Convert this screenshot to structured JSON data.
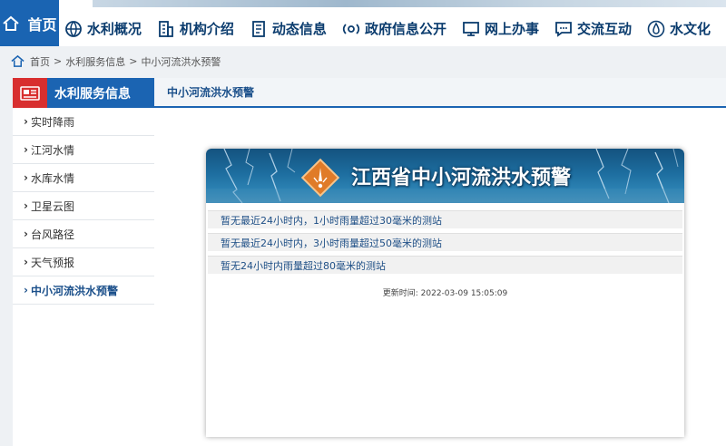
{
  "nav": {
    "home": "首页",
    "items": [
      {
        "label": "水利概况",
        "icon": "globe-icon"
      },
      {
        "label": "机构介绍",
        "icon": "building-icon"
      },
      {
        "label": "动态信息",
        "icon": "document-icon"
      },
      {
        "label": "政府信息公开",
        "icon": "broadcast-icon"
      },
      {
        "label": "网上办事",
        "icon": "monitor-icon"
      },
      {
        "label": "交流互动",
        "icon": "chat-icon"
      },
      {
        "label": "水文化",
        "icon": "water-drop-icon"
      }
    ]
  },
  "breadcrumb": {
    "home": "首页",
    "level1": "水利服务信息",
    "level2": "中小河流洪水预警",
    "separator": ">"
  },
  "sidebar": {
    "title": "水利服务信息",
    "items": [
      {
        "label": "实时降雨",
        "active": false
      },
      {
        "label": "江河水情",
        "active": false
      },
      {
        "label": "水库水情",
        "active": false
      },
      {
        "label": "卫星云图",
        "active": false
      },
      {
        "label": "台风路径",
        "active": false
      },
      {
        "label": "天气预报",
        "active": false
      },
      {
        "label": "中小河流洪水预警",
        "active": true
      }
    ]
  },
  "main": {
    "tab": "中小河流洪水预警",
    "banner_title": "江西省中小河流洪水预警",
    "rows": [
      "暂无最近24小时内，1小时雨量超过30毫米的测站",
      "暂无最近24小时内，3小时雨量超过50毫米的测站",
      "暂无24小时内雨量超过80毫米的测站"
    ],
    "update_label": "更新时间:",
    "update_time": "2022-03-09 15:05:09"
  },
  "colors": {
    "brand_blue": "#1b64b2",
    "accent_red": "#d82f2f",
    "warning_orange": "#e07b28",
    "nav_text": "#0b3c6e"
  }
}
